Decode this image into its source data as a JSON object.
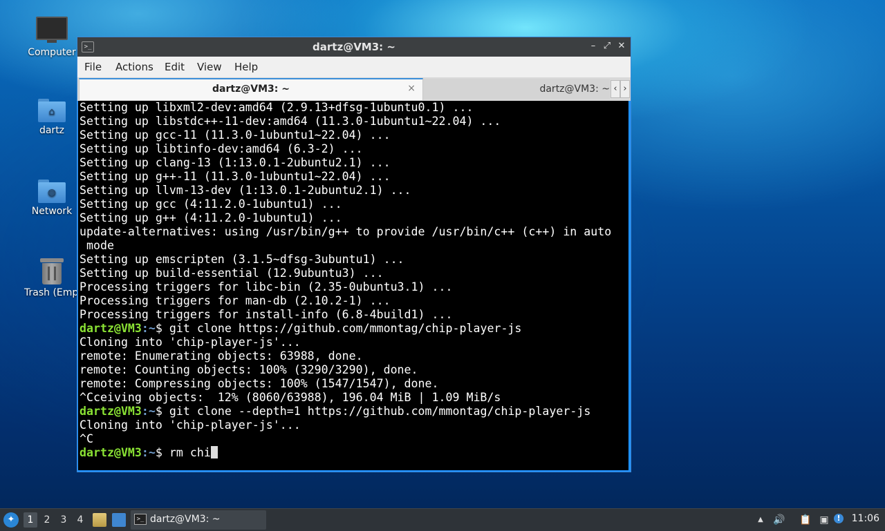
{
  "desktop": {
    "icons": [
      {
        "label": "Computer"
      },
      {
        "label": "dartz"
      },
      {
        "label": "Network"
      },
      {
        "label": "Trash (Empty)"
      }
    ]
  },
  "window": {
    "title": "dartz@VM3: ~",
    "app_icon_glyph": ">_",
    "controls": {
      "minimize": "–",
      "maximize": "⤢",
      "close": "✕"
    },
    "menu": [
      "File",
      "Actions",
      "Edit",
      "View",
      "Help"
    ],
    "tabs": [
      {
        "label": "dartz@VM3: ~",
        "active": true
      },
      {
        "label": "dartz@VM3: ~",
        "active": false
      }
    ],
    "tab_close_glyph": "×",
    "tab_scroll": {
      "left": "‹",
      "right": "›"
    }
  },
  "terminal": {
    "prompt": {
      "user_host": "dartz@VM3",
      "colon": ":",
      "path": "~",
      "symbol": "$"
    },
    "colors": {
      "user_host": "#8ae234",
      "path": "#729fcf",
      "text": "#ffffff",
      "background": "#000000"
    },
    "lines": [
      {
        "text": "Setting up libxml2-dev:amd64 (2.9.13+dfsg-1ubuntu0.1) ..."
      },
      {
        "text": "Setting up libstdc++-11-dev:amd64 (11.3.0-1ubuntu1~22.04) ..."
      },
      {
        "text": "Setting up gcc-11 (11.3.0-1ubuntu1~22.04) ..."
      },
      {
        "text": "Setting up libtinfo-dev:amd64 (6.3-2) ..."
      },
      {
        "text": "Setting up clang-13 (1:13.0.1-2ubuntu2.1) ..."
      },
      {
        "text": "Setting up g++-11 (11.3.0-1ubuntu1~22.04) ..."
      },
      {
        "text": "Setting up llvm-13-dev (1:13.0.1-2ubuntu2.1) ..."
      },
      {
        "text": "Setting up gcc (4:11.2.0-1ubuntu1) ..."
      },
      {
        "text": "Setting up g++ (4:11.2.0-1ubuntu1) ..."
      },
      {
        "text": "update-alternatives: using /usr/bin/g++ to provide /usr/bin/c++ (c++) in auto"
      },
      {
        "text": " mode"
      },
      {
        "text": "Setting up emscripten (3.1.5~dfsg-3ubuntu1) ..."
      },
      {
        "text": "Setting up build-essential (12.9ubuntu3) ..."
      },
      {
        "text": "Processing triggers for libc-bin (2.35-0ubuntu3.1) ..."
      },
      {
        "text": "Processing triggers for man-db (2.10.2-1) ..."
      },
      {
        "text": "Processing triggers for install-info (6.8-4build1) ..."
      },
      {
        "text": " git clone https://github.com/mmontag/chip-player-js",
        "prompt": true
      },
      {
        "text": "Cloning into 'chip-player-js'..."
      },
      {
        "text": "remote: Enumerating objects: 63988, done."
      },
      {
        "text": "remote: Counting objects: 100% (3290/3290), done."
      },
      {
        "text": "remote: Compressing objects: 100% (1547/1547), done."
      },
      {
        "text": "^Cceiving objects:  12% (8060/63988), 196.04 MiB | 1.09 MiB/s"
      },
      {
        "text": " git clone --depth=1 https://github.com/mmontag/chip-player-js",
        "prompt": true
      },
      {
        "text": "Cloning into 'chip-player-js'..."
      },
      {
        "text": "^C"
      },
      {
        "text": " rm chi",
        "prompt": true,
        "cursor": true
      }
    ]
  },
  "taskbar": {
    "start_icon": "start-menu-icon",
    "workspaces": [
      "1",
      "2",
      "3",
      "4"
    ],
    "active_workspace": "1",
    "task": {
      "label": "dartz@VM3: ~",
      "icon_glyph": ">_"
    },
    "tray": {
      "up_arrow": "▲",
      "volume": "🔊",
      "clipboard": "📋",
      "network": "▣",
      "notification": "!"
    },
    "clock": "11:06"
  }
}
